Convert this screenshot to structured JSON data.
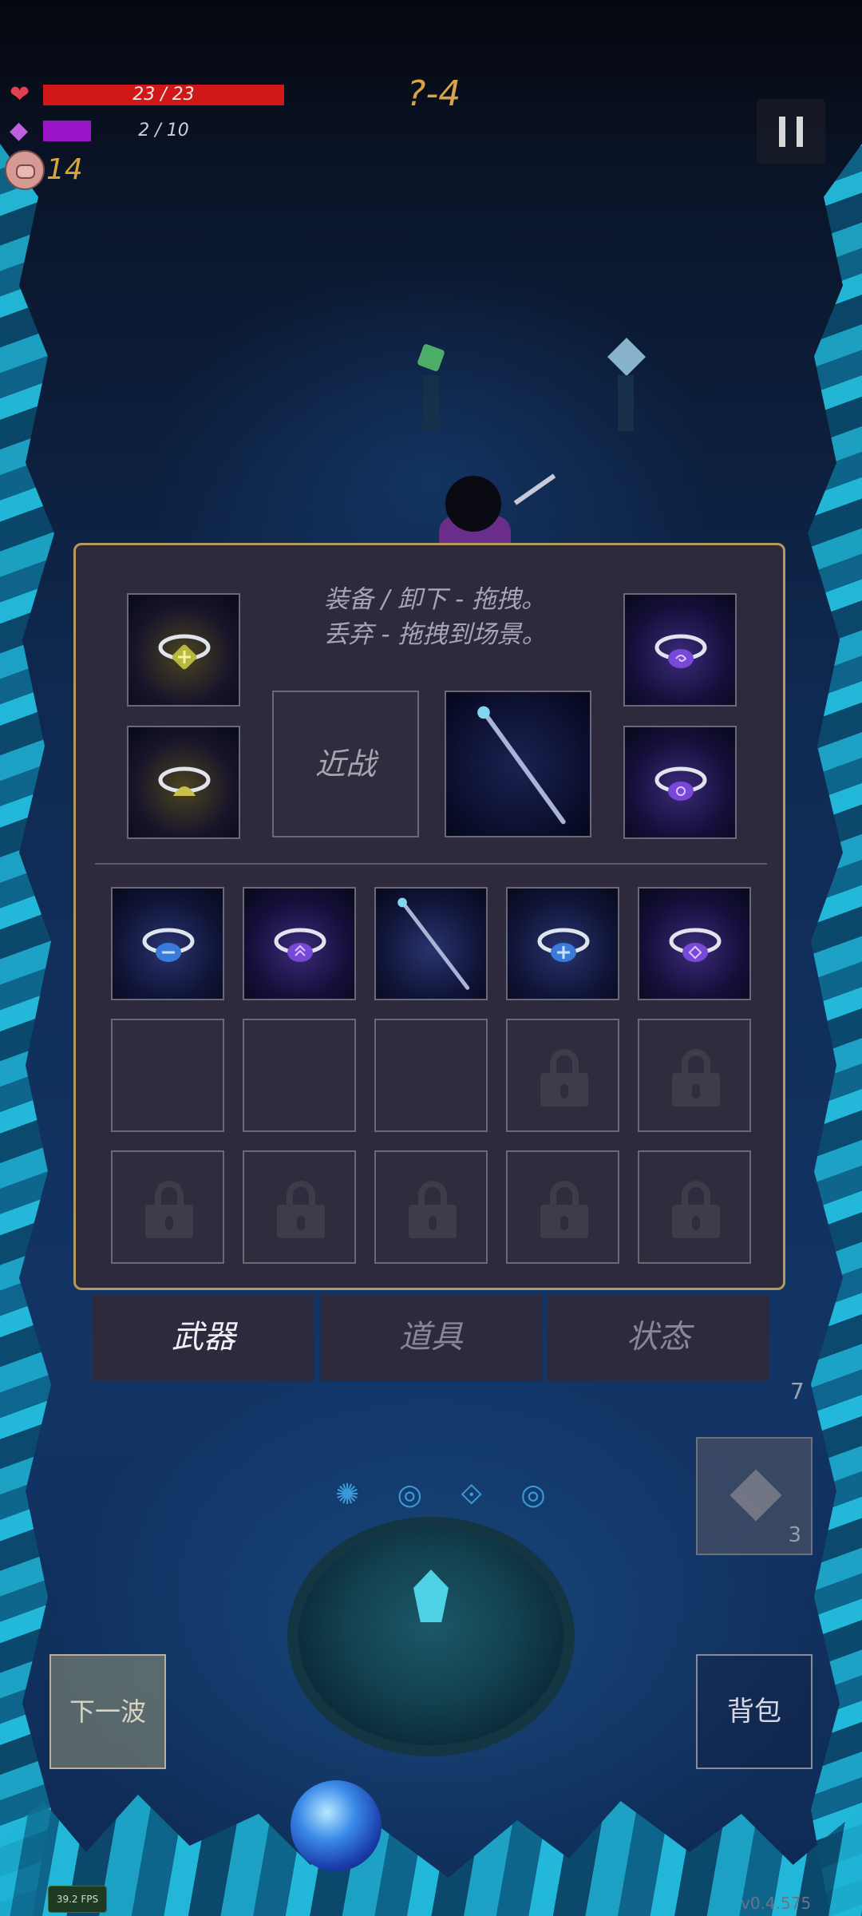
{
  "hud": {
    "hp_text": "23 / 23",
    "hp_fraction": 1.0,
    "mana_text": "2 / 10",
    "mana_fraction": 0.2,
    "coins": "14",
    "level": "?-4"
  },
  "panel": {
    "hint_line1": "装备 / 卸下 - 拖拽。",
    "hint_line2": "丢弃 - 拖拽到场景。",
    "melee_label": "近战"
  },
  "tabs": {
    "weapons": "武器",
    "items": "道具",
    "status": "状态"
  },
  "buttons": {
    "next_wave": "下一波",
    "backpack": "背包",
    "skill_count": "3"
  },
  "misc": {
    "side_number": "7",
    "fps": "39.2 FPS",
    "version": "v0.4.575"
  },
  "colors": {
    "hp": "#d01818",
    "mana": "#9a14c8",
    "panel_border": "#b79a5b",
    "coin": "#d9a53a"
  }
}
